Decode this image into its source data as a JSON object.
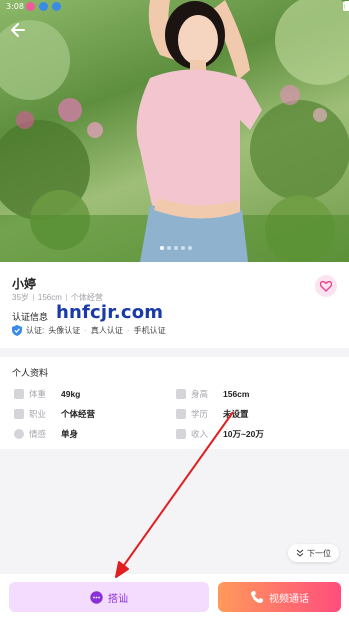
{
  "status_bar": {
    "time": "3:08"
  },
  "profile": {
    "name": "小婷",
    "age": "35岁",
    "height": "156cm",
    "occupation": "个体经营"
  },
  "verification": {
    "title": "认证信息",
    "watermark": "hnfcjr.com",
    "prefix": "认证:",
    "items": [
      "头像认证",
      "真人认证",
      "手机认证"
    ]
  },
  "personal_info": {
    "heading": "个人资料",
    "rows": [
      {
        "label": "体重",
        "value": "49kg",
        "icon": "weight-icon"
      },
      {
        "label": "身高",
        "value": "156cm",
        "icon": "ruler-icon"
      },
      {
        "label": "职业",
        "value": "个体经营",
        "icon": "briefcase-icon"
      },
      {
        "label": "学历",
        "value": "未设置",
        "icon": "graduation-cap-icon"
      },
      {
        "label": "情感",
        "value": "单身",
        "icon": "heart-outline-icon"
      },
      {
        "label": "收入",
        "value": "10万~20万",
        "icon": "wallet-icon"
      }
    ]
  },
  "next_button": {
    "label": "下一位"
  },
  "bottom_bar": {
    "chat_label": "搭讪",
    "video_label": "视频通话"
  },
  "colors": {
    "accent_purple": "#8a30d8",
    "chat_bg": "#f4dcff",
    "video_gradient_start": "#ff9a5a",
    "video_gradient_end": "#ff4d7d",
    "like_pink": "#e8428f",
    "arrow_red": "#e02020"
  }
}
